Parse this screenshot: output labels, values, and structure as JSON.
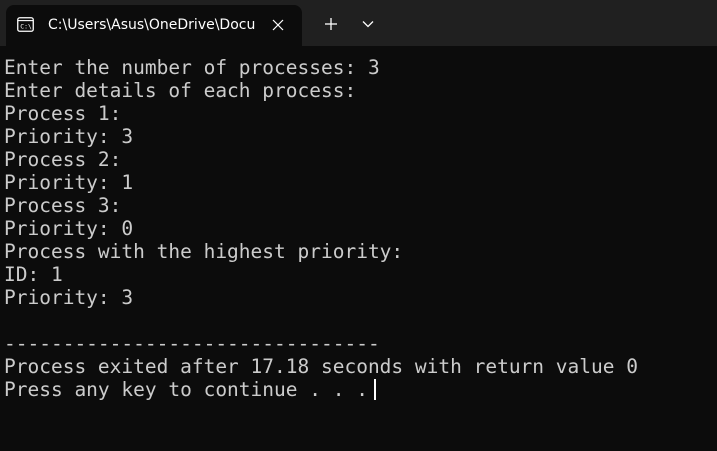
{
  "tab": {
    "title": "C:\\Users\\Asus\\OneDrive\\Docu",
    "icon": "console-icon",
    "close_icon": "close-icon"
  },
  "tabbar": {
    "new_tab_icon": "plus-icon",
    "dropdown_icon": "chevron-down-icon"
  },
  "colors": {
    "background": "#0c0c0c",
    "tabbar": "#202020",
    "text": "#cccccc"
  },
  "terminal": {
    "lines": [
      "Enter the number of processes: 3",
      "Enter details of each process:",
      "Process 1:",
      "Priority: 3",
      "Process 2:",
      "Priority: 1",
      "Process 3:",
      "Priority: 0",
      "Process with the highest priority:",
      "ID: 1",
      "Priority: 3",
      "",
      "--------------------------------",
      "Process exited after 17.18 seconds with return value 0",
      "Press any key to continue . . ."
    ]
  }
}
